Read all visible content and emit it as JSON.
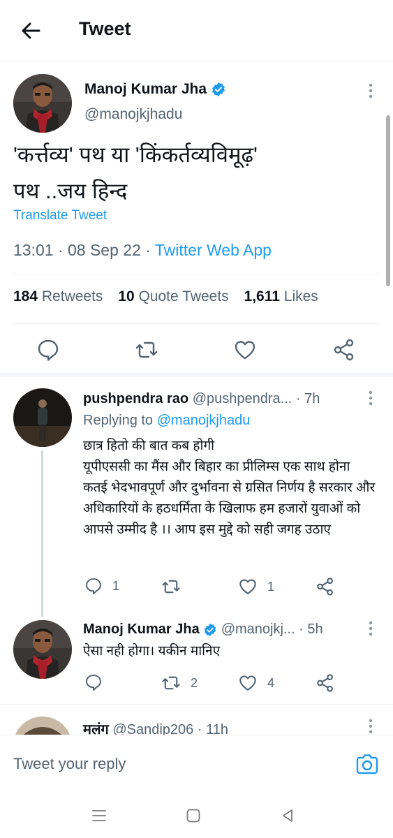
{
  "header": {
    "title": "Tweet"
  },
  "main_tweet": {
    "author_name": "Manoj Kumar Jha",
    "author_handle": "@manojkjhadu",
    "text": "'कर्त्तव्य' पथ या 'किंकर्तव्यविमूढ़'\nपथ ..जय हिन्द",
    "translate_label": "Translate Tweet",
    "time": "13:01 · 08 Sep 22 · ",
    "app": "Twitter Web App",
    "stats": {
      "retweets_count": "184",
      "retweets_label": "Retweets",
      "quotes_count": "10",
      "quotes_label": "Quote Tweets",
      "likes_count": "1,611",
      "likes_label": "Likes"
    }
  },
  "replies": [
    {
      "name": "pushpendra rao",
      "handle": "@pushpendra...",
      "time": " · 7h",
      "replying_prefix": "Replying to ",
      "replying_to": "@manojkjhadu",
      "text": "छात्र हितो की बात कब होगी\nयूपीएससी का मैंस और बिहार का प्रीलिम्स एक साथ होना कतई भेदभावपूर्ण और दुर्भावना से ग्रसित निर्णय है सरकार और अधिकारियों के हठधर्मिता के खिलाफ हम हजारों युवाओं को आपसे उम्मीद है ।। आप इस मुद्दे को सही जगह उठाए",
      "reply_count": "1",
      "retweet_count": "",
      "like_count": "1"
    },
    {
      "name": "Manoj Kumar Jha",
      "handle": "@manojkj...",
      "time": " · 5h",
      "text": "ऐसा नही होगा। यकीन मानिए",
      "reply_count": "",
      "retweet_count": "2",
      "like_count": "4"
    },
    {
      "name": "मलंग",
      "handle": "@Sandip206",
      "time": " · 11h"
    }
  ],
  "reply_bar": {
    "placeholder": "Tweet your reply"
  },
  "colors": {
    "accent": "#1d9bf0",
    "muted": "#536471",
    "text": "#0f1419"
  }
}
